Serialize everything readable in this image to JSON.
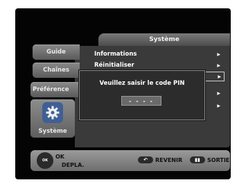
{
  "header": {
    "title": "Système"
  },
  "sidebar": {
    "tabs": [
      {
        "label": "Guide"
      },
      {
        "label": "Chaînes"
      },
      {
        "label": "Préférence"
      },
      {
        "label": "Système"
      }
    ]
  },
  "menu": {
    "items": [
      {
        "label": "Informations",
        "arrow": "▶"
      },
      {
        "label": "Réinitialiser",
        "arrow": "▶"
      },
      {
        "label": "",
        "arrow": "▶"
      },
      {
        "label": "",
        "arrow": "▶"
      },
      {
        "label": "",
        "arrow": "▶"
      }
    ]
  },
  "pin_dialog": {
    "title": "Veuillez saisir le code PIN",
    "value": "- - - -"
  },
  "footer": {
    "dpad_label": "OK",
    "ok_label": "OK",
    "move_label": "DEPLA.",
    "back_label": "REVENIR",
    "exit_label": "SORTIE"
  }
}
